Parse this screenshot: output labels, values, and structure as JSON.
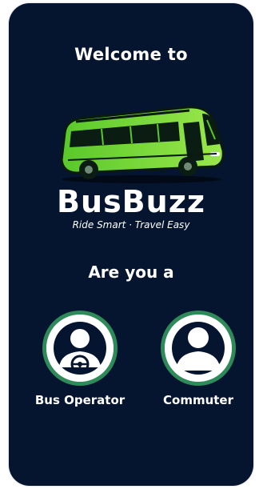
{
  "welcome": {
    "title": "Welcome to"
  },
  "brand": {
    "name": "BusBuzz",
    "tagline": "Ride Smart · Travel Easy",
    "logo_icon": "bus-icon"
  },
  "question": "Are you a",
  "roles": [
    {
      "label": "Bus Operator",
      "icon": "driver-steering-wheel-icon"
    },
    {
      "label": "Commuter",
      "icon": "user-avatar-icon"
    }
  ],
  "colors": {
    "background": "#06152f",
    "accent_green": "#2e8a58",
    "bus_green": "#7cd63c",
    "text": "#ffffff"
  }
}
